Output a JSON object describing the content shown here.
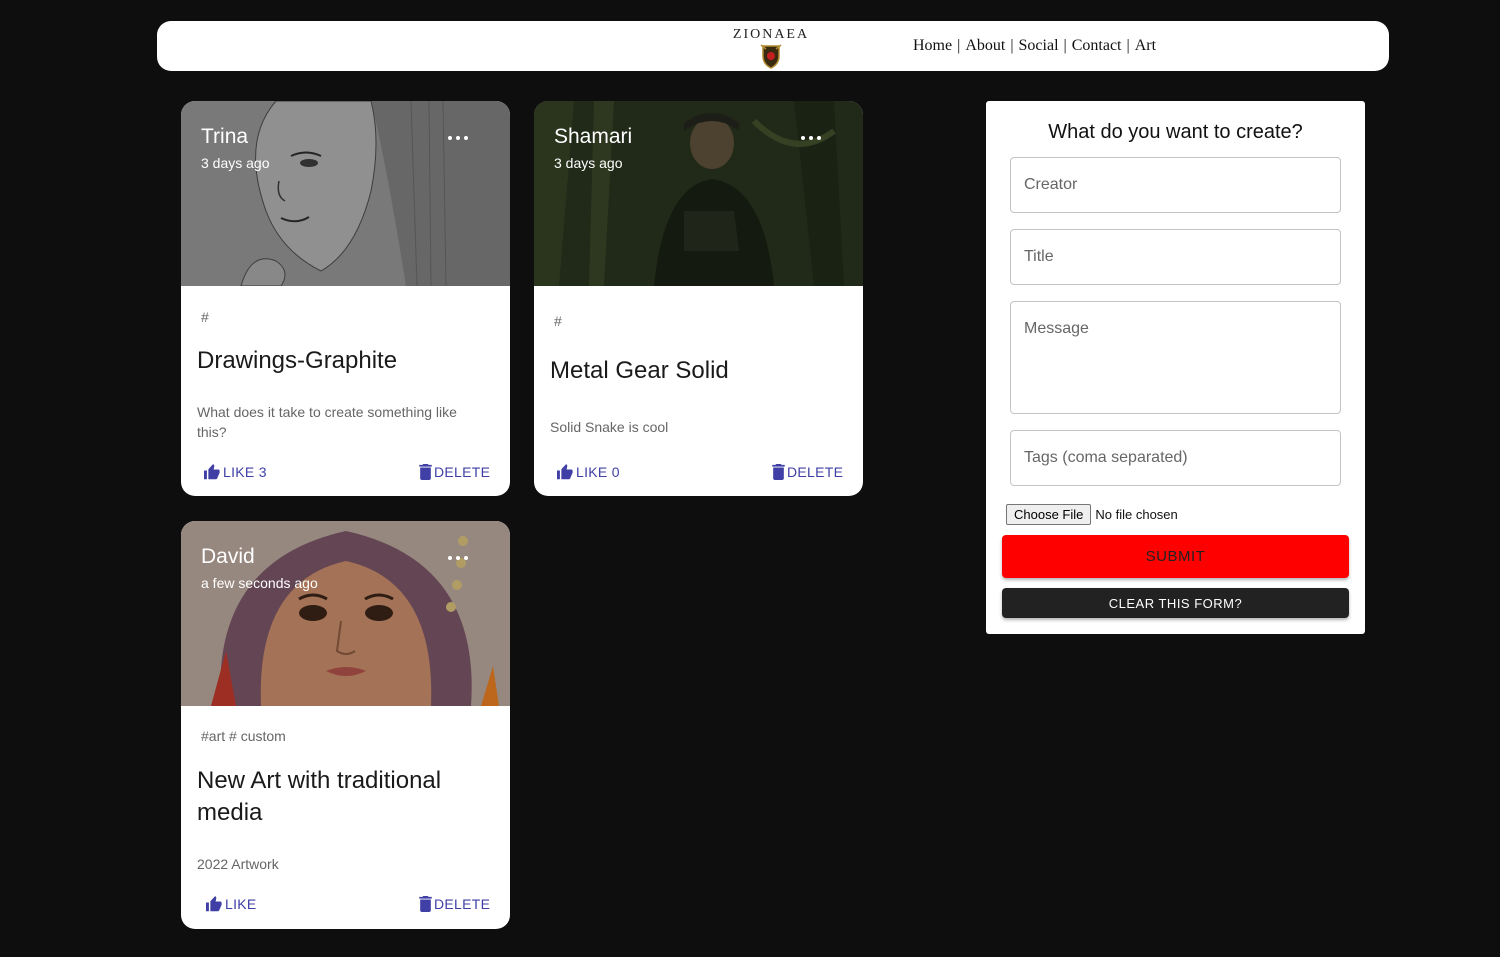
{
  "header": {
    "logo_text": "ZIONAEA",
    "nav": [
      {
        "label": "Home"
      },
      {
        "label": "About"
      },
      {
        "label": "Social"
      },
      {
        "label": "Contact"
      },
      {
        "label": "Art"
      }
    ],
    "separator": "|"
  },
  "posts": [
    {
      "creator": "Trina",
      "time": "3 days ago",
      "tags": "#",
      "title": "Drawings-Graphite",
      "message": "What does it take to create something like this?",
      "like_label": "LIKE 3",
      "delete_label": "DELETE",
      "image_icon": "graphite-portrait-image"
    },
    {
      "creator": "Shamari",
      "time": "3 days ago",
      "tags": "#",
      "title": "Metal Gear Solid",
      "message": "Solid Snake is cool",
      "like_label": "LIKE 0",
      "delete_label": "DELETE",
      "image_icon": "jungle-soldier-image"
    },
    {
      "creator": "David",
      "time": "a few seconds ago",
      "tags": "#art # custom",
      "title": "New Art with traditional media",
      "message": "2022 Artwork",
      "like_label": "LIKE",
      "delete_label": "DELETE",
      "image_icon": "painted-portrait-image"
    }
  ],
  "form": {
    "title": "What do you want to create?",
    "creator_placeholder": "Creator",
    "title_placeholder": "Title",
    "message_placeholder": "Message",
    "tags_placeholder": "Tags (coma separated)",
    "choose_file_label": "Choose File",
    "file_status": "No file chosen",
    "submit_label": "SUBMIT",
    "clear_label": "CLEAR THIS FORM?"
  },
  "colors": {
    "background": "#0e0e0e",
    "accent": "#3f3fa6",
    "submit": "#ff0000",
    "clear": "#222222"
  }
}
